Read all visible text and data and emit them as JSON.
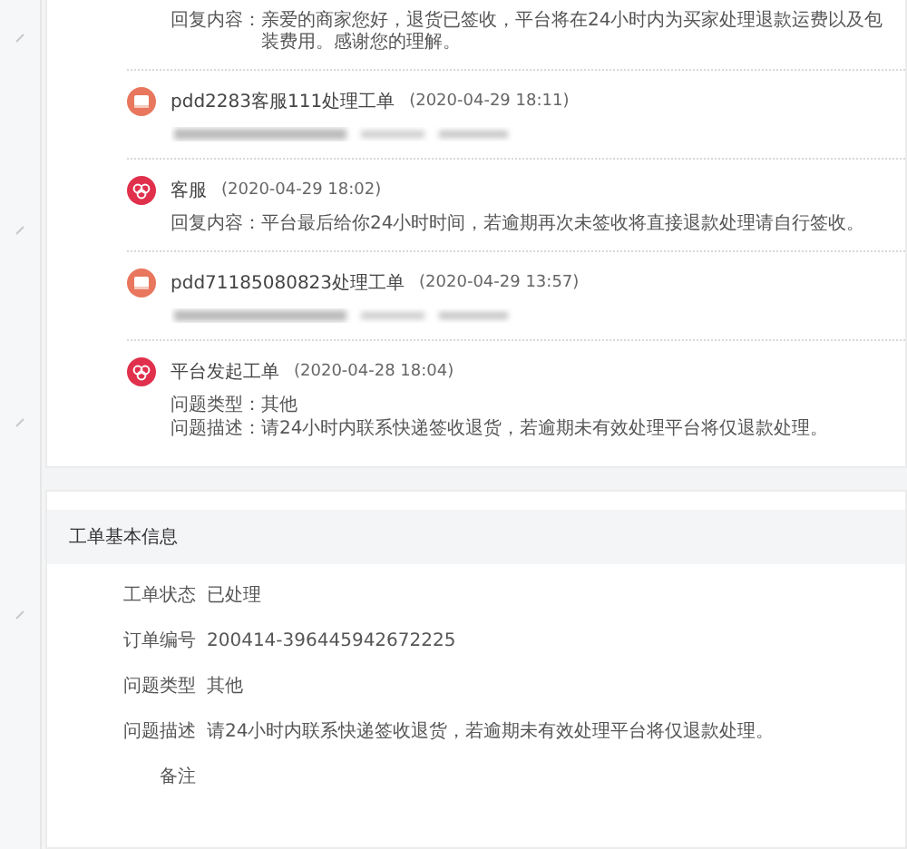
{
  "timeline": [
    {
      "kind": "reply",
      "lines": [
        {
          "label": "回复内容：",
          "value": "亲爱的商家您好，退货已签收，平台将在24小时内为买家处理退款运费以及包装费用。感谢您的理解。"
        }
      ]
    },
    {
      "kind": "merchant",
      "author": "pdd2283客服111处理工单",
      "time": "(2020-04-29 18:11)",
      "blurred": true
    },
    {
      "kind": "platform",
      "author": "客服",
      "time": "(2020-04-29 18:02)",
      "lines": [
        {
          "label": "回复内容：",
          "value": "平台最后给你24小时时间，若逾期再次未签收将直接退款处理请自行签收。"
        }
      ]
    },
    {
      "kind": "merchant",
      "author": "pdd71185080823处理工单",
      "time": "(2020-04-29 13:57)",
      "blurred": true
    },
    {
      "kind": "platform",
      "author": "平台发起工单",
      "time": "(2020-04-28 18:04)",
      "lines": [
        {
          "label": "问题类型：",
          "value": "其他"
        },
        {
          "label": "问题描述：",
          "value": "请24小时内联系快递签收退货，若逾期未有效处理平台将仅退款处理。"
        }
      ]
    }
  ],
  "info": {
    "title": "工单基本信息",
    "fields": [
      {
        "label": "工单状态",
        "value": "已处理"
      },
      {
        "label": "订单编号",
        "value": "200414-396445942672225"
      },
      {
        "label": "问题类型",
        "value": "其他"
      },
      {
        "label": "问题描述",
        "value": "请24小时内联系快递签收退货，若逾期未有效处理平台将仅退款处理。"
      },
      {
        "label": "备注"
      }
    ]
  }
}
